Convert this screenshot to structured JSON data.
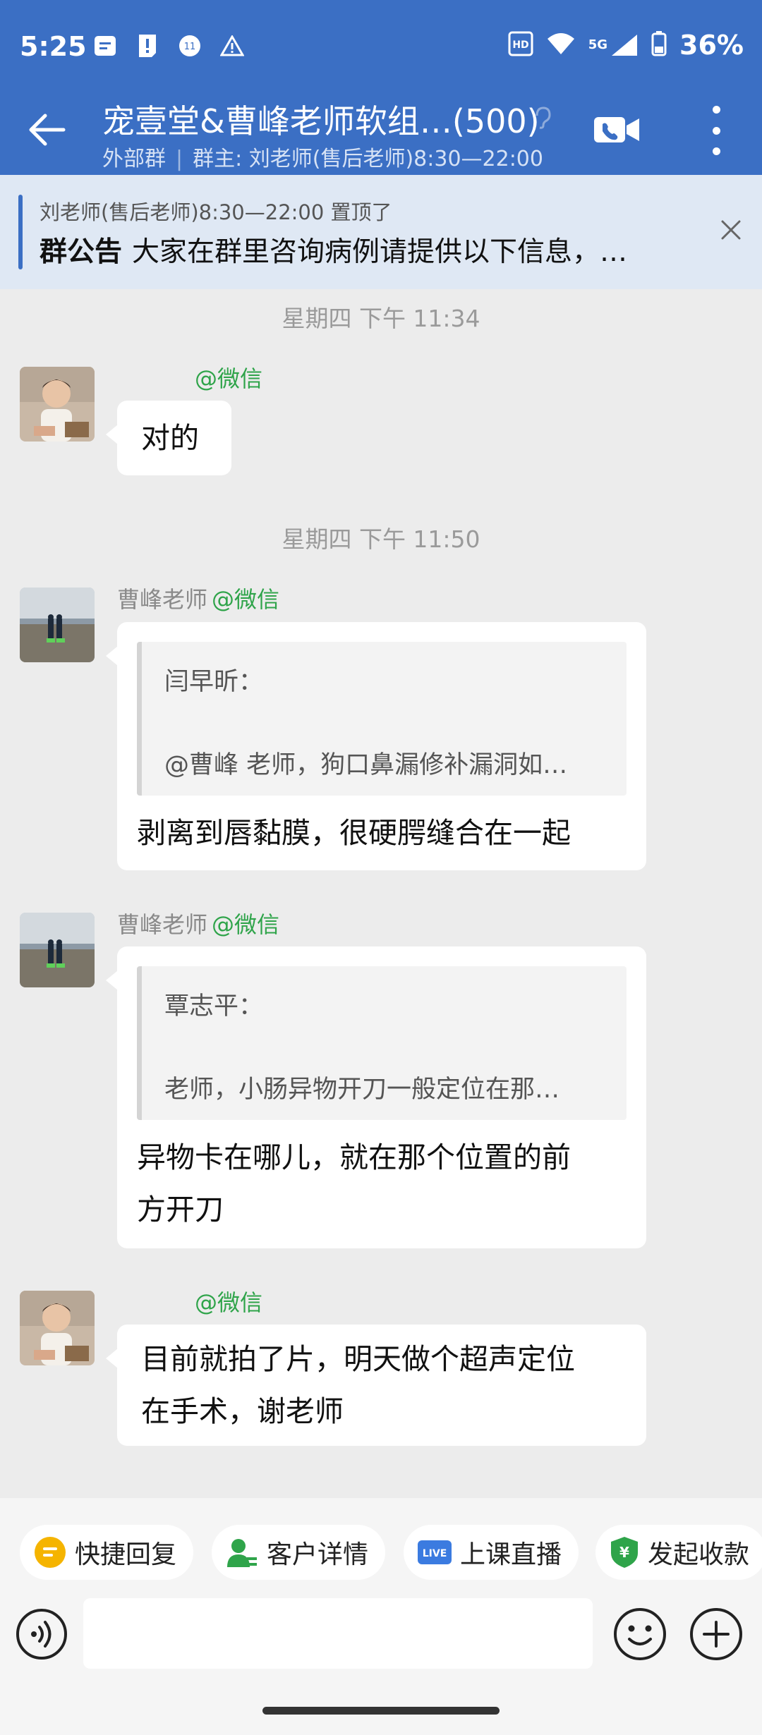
{
  "status_bar": {
    "time": "5:25",
    "battery": "36%",
    "signal_label": "5G",
    "icons": [
      "message-notification-icon",
      "alert-icon",
      "app-badge-icon",
      "warning-icon",
      "hd-icon",
      "wifi-icon",
      "signal-icon",
      "battery-icon"
    ]
  },
  "header": {
    "title": "宠壹堂&曹峰老师软组…(500)",
    "subtitle_external": "外部群",
    "subtitle_owner": "群主: 刘老师(售后老师)8:30—22:00"
  },
  "pinned": {
    "meta": "刘老师(售后老师)8:30—22:00 置顶了",
    "tag": "群公告",
    "text": "大家在群里咨询病例请提供以下信息，…"
  },
  "messages": [
    {
      "timestamp": "星期四  下午 11:34",
      "sender_name": "",
      "source": "@微信",
      "text": "对的"
    },
    {
      "timestamp": "星期四  下午 11:50",
      "sender_name": "曹峰老师",
      "source": "@微信",
      "quote_name": "闫早昕：",
      "quote_text": "@曹峰 老师，狗口鼻漏修补漏洞如…",
      "text": "剥离到唇黏膜，很硬腭缝合在一起"
    },
    {
      "sender_name": "曹峰老师",
      "source": "@微信",
      "quote_name": "覃志平：",
      "quote_text": "老师，小肠异物开刀一般定位在那…",
      "text_line1": "异物卡在哪儿，就在那个位置的前",
      "text_line2": "方开刀"
    },
    {
      "sender_name": "",
      "source": "@微信",
      "text_line1": "目前就拍了片，明天做个超声定位",
      "text_line2": "在手术，谢老师"
    }
  ],
  "quick_actions": [
    {
      "label": "快捷回复",
      "icon": "quick-reply-icon",
      "color": "#f5b400"
    },
    {
      "label": "客户详情",
      "icon": "customer-icon",
      "color": "#2fa44a"
    },
    {
      "label": "上课直播",
      "icon": "live-icon",
      "color": "#3b7be0"
    },
    {
      "label": "发起收款",
      "icon": "payment-icon",
      "color": "#2fa44a"
    }
  ],
  "input": {
    "placeholder": ""
  },
  "colors": {
    "header_bg": "#3b6fc4",
    "wechat_green": "#2fa44a",
    "chat_bg": "#ececec"
  }
}
